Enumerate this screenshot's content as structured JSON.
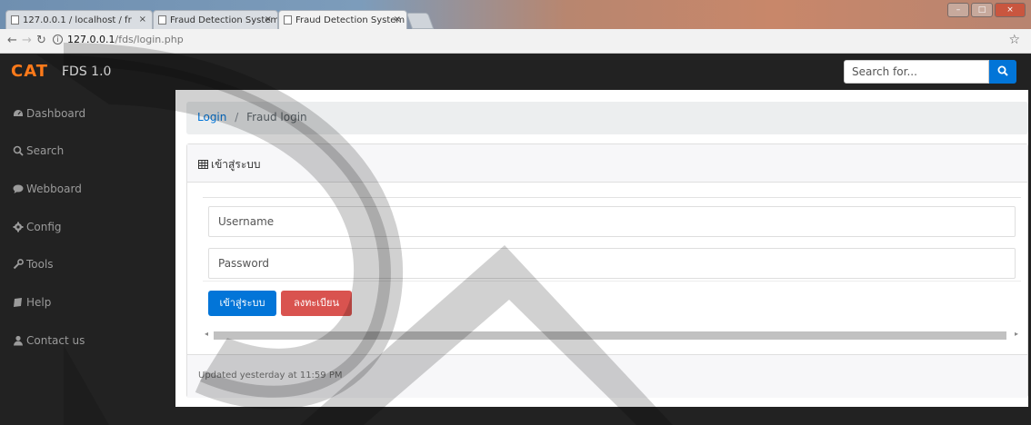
{
  "browser": {
    "tabs": [
      {
        "label": "127.0.0.1 / localhost / fr"
      },
      {
        "label": "Fraud Detection System"
      },
      {
        "label": "Fraud Detection System"
      }
    ],
    "url_host": "127.0.0.1",
    "url_path": "/fds/login.php"
  },
  "navbar": {
    "brand": "CAT",
    "version": "FDS 1.0",
    "search_placeholder": "Search for..."
  },
  "sidebar": {
    "items": [
      {
        "label": "Dashboard",
        "icon": "dashboard-icon"
      },
      {
        "label": "Search",
        "icon": "search-icon"
      },
      {
        "label": "Webboard",
        "icon": "comment-icon"
      },
      {
        "label": "Config",
        "icon": "gear-icon"
      },
      {
        "label": "Tools",
        "icon": "wrench-icon"
      },
      {
        "label": "Help",
        "icon": "book-icon"
      },
      {
        "label": "Contact us",
        "icon": "user-icon"
      }
    ]
  },
  "breadcrumb": {
    "link": "Login",
    "separator": "/",
    "current": "Fraud login"
  },
  "card": {
    "title": "เข้าสู่ระบบ",
    "username_placeholder": "Username",
    "password_placeholder": "Password",
    "login_button": "เข้าสู่ระบบ",
    "register_button": "ลงทะเบียน",
    "footer": "Updated yesterday at 11:59 PM"
  },
  "colors": {
    "navbar_bg": "#222222",
    "brand": "#ff7a1a",
    "primary": "#0275d8",
    "danger": "#d9534f"
  }
}
